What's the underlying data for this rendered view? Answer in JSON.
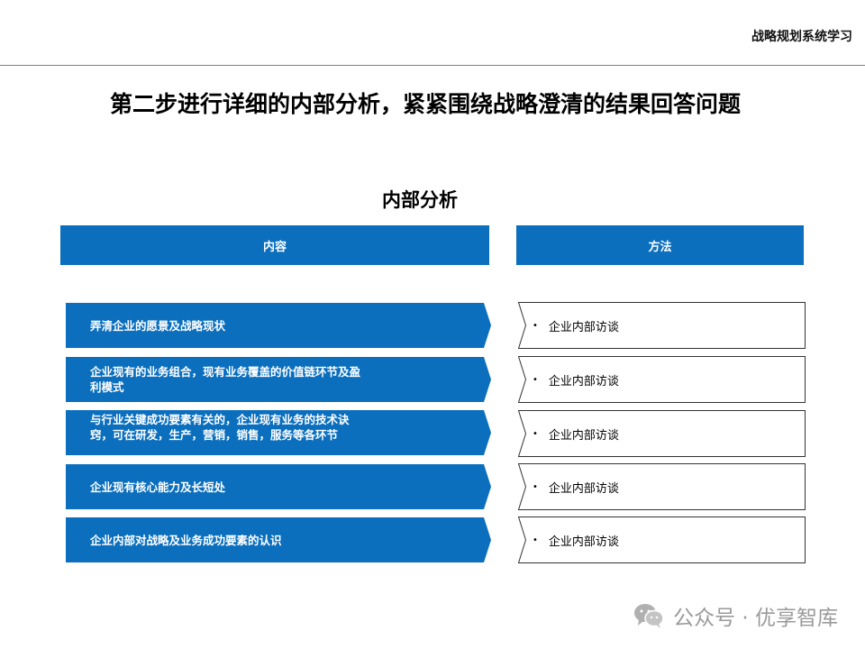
{
  "header": {
    "title": "战略规划系统学习"
  },
  "slide": {
    "title": "第二步进行详细的内部分析，紧紧围绕战略澄清的结果回答问题",
    "section_title": "内部分析"
  },
  "columns": {
    "content": "内容",
    "method": "方法"
  },
  "rows": [
    {
      "content": "弄清企业的愿景及战略现状",
      "method": "企业内部访谈"
    },
    {
      "content": "企业现有的业务组合，现有业务覆盖的价值链环节及盈利模式",
      "method": "企业内部访谈"
    },
    {
      "content": "与行业关键成功要素有关的，企业现有业务的技术诀窍，可在研发，生产，营销，销售，服务等各环节",
      "method": "企业内部访谈"
    },
    {
      "content": "企业现有核心能力及长短处",
      "method": "企业内部访谈"
    },
    {
      "content": "企业内部对战略及业务成功要素的认识",
      "method": "企业内部访谈"
    }
  ],
  "watermark": {
    "text": "公众号 · 优享智库",
    "icon": "wechat-icon"
  },
  "colors": {
    "accent": "#0b6fbe",
    "border": "#333333",
    "watermark": "#9a9a9a"
  }
}
